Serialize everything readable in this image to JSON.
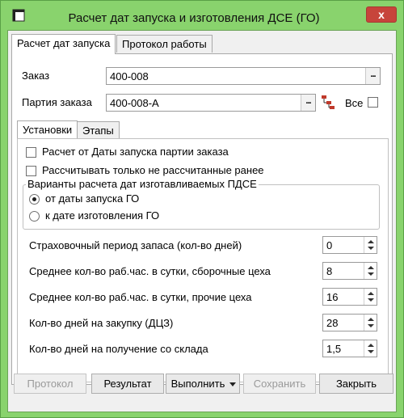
{
  "window": {
    "title": "Расчет дат запуска и изготовления ДСЕ (ГО)",
    "close_glyph": "x"
  },
  "outer_tabs": [
    {
      "label": "Расчет дат запуска",
      "active": true
    },
    {
      "label": "Протокол работы",
      "active": false
    }
  ],
  "order": {
    "label": "Заказ",
    "value": "400-008"
  },
  "batch": {
    "label": "Партия заказа",
    "value": "400-008-A",
    "all_label": "Все",
    "all_checked": false
  },
  "browse_glyph": "...",
  "inner_tabs": [
    {
      "label": "Установки",
      "active": true
    },
    {
      "label": "Этапы",
      "active": false
    }
  ],
  "options": [
    {
      "label": "Расчет от Даты запуска партии заказа",
      "checked": false
    },
    {
      "label": "Рассчитывать только не рассчитанные ранее",
      "checked": false
    }
  ],
  "variants": {
    "title": "Варианты расчета дат изготавливаемых ПДСЕ",
    "items": [
      {
        "label": "от даты запуска ГО",
        "selected": true
      },
      {
        "label": "к дате изготовления ГО",
        "selected": false
      }
    ]
  },
  "params": [
    {
      "label": "Страховочный период запаса (кол-во дней)",
      "value": "0"
    },
    {
      "label": "Среднее кол-во раб.час. в сутки, сборочные цеха",
      "value": "8"
    },
    {
      "label": "Среднее кол-во раб.час. в сутки, прочие цеха",
      "value": "16"
    },
    {
      "label": "Кол-во дней на закупку (ДЦЗ)",
      "value": "28"
    },
    {
      "label": "Кол-во дней на получение со склада",
      "value": "1,5"
    }
  ],
  "buttons": {
    "protocol": "Протокол",
    "result": "Результат",
    "execute": "Выполнить",
    "save": "Сохранить",
    "close": "Закрыть"
  },
  "colors": {
    "frame": "#89d36d",
    "close_button": "#c7443b"
  }
}
